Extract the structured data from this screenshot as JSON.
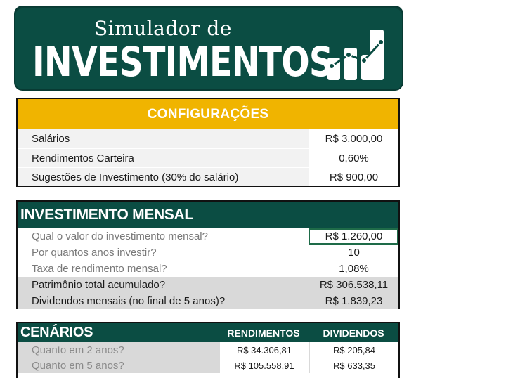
{
  "banner": {
    "subtitle": "Simulador de",
    "title": "INVESTIMENTOS",
    "logo_icon": "bar-growth-chart-icon"
  },
  "colors": {
    "brand_green": "#0b4d43",
    "accent_yellow": "#f0b400",
    "grey_row": "#d9d9d9"
  },
  "config": {
    "header": "CONFIGURAÇÕES",
    "rows": [
      {
        "label": "Salários",
        "value": "R$ 3.000,00"
      },
      {
        "label": "Rendimentos Carteira",
        "value": "0,60%"
      },
      {
        "label": "Sugestões de Investimento (30% do salário)",
        "value": "R$ 900,00"
      }
    ]
  },
  "mensal": {
    "header": "INVESTIMENTO MENSAL",
    "rows": [
      {
        "label": "Qual o valor do investimento mensal?",
        "value": "R$ 1.260,00"
      },
      {
        "label": "Por quantos anos investir?",
        "value": "10"
      },
      {
        "label": "Taxa de rendimento mensal?",
        "value": "1,08%"
      },
      {
        "label": "Patrimônio total acumulado?",
        "value": "R$ 306.538,11"
      },
      {
        "label": "Dividendos mensais (no final de 5 anos)?",
        "value": "R$ 1.839,23"
      }
    ]
  },
  "cenarios": {
    "header": "CENÁRIOS",
    "col_rendimentos": "RENDIMENTOS",
    "col_dividendos": "DIVIDENDOS",
    "rows": [
      {
        "label": "Quanto em 2 anos?",
        "rendimentos": "R$ 34.306,81",
        "dividendos": "R$ 205,84"
      },
      {
        "label": "Quanto em 5 anos?",
        "rendimentos": "R$ 105.558,91",
        "dividendos": "R$ 633,35"
      }
    ]
  }
}
